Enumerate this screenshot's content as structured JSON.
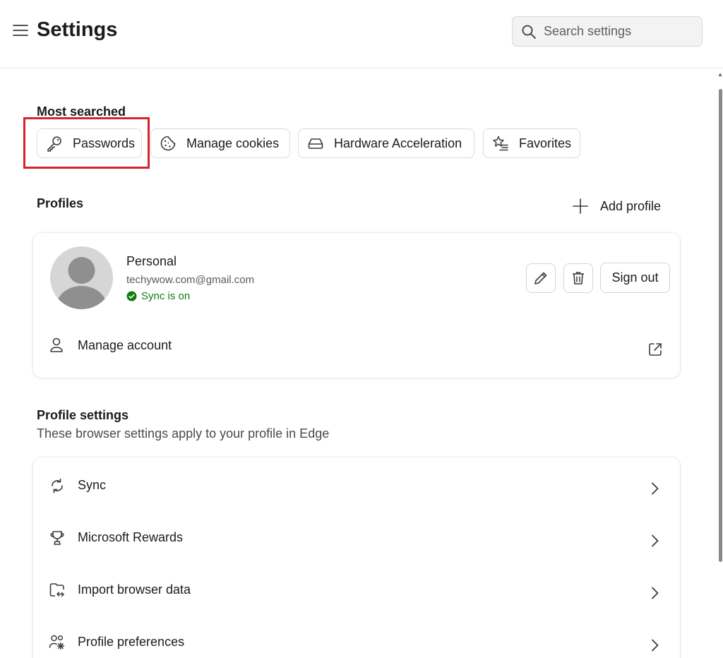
{
  "header": {
    "title": "Settings",
    "search_placeholder": "Search settings"
  },
  "most_searched": {
    "heading": "Most searched",
    "chips": [
      {
        "label": "Passwords",
        "icon": "key-icon"
      },
      {
        "label": "Manage cookies",
        "icon": "cookie-icon"
      },
      {
        "label": "Hardware Acceleration",
        "icon": "drive-icon"
      },
      {
        "label": "Favorites",
        "icon": "star-list-icon"
      }
    ],
    "highlight_color": "#d3242f"
  },
  "profiles": {
    "heading": "Profiles",
    "add_profile_label": "Add profile",
    "profile": {
      "name": "Personal",
      "email": "techywow.com@gmail.com",
      "sync_status": "Sync is on",
      "sync_color": "#107c10"
    },
    "sign_out_label": "Sign out",
    "manage_account_label": "Manage account"
  },
  "profile_settings": {
    "heading": "Profile settings",
    "subtext": "These browser settings apply to your profile in Edge",
    "items": [
      {
        "label": "Sync",
        "icon": "sync-icon"
      },
      {
        "label": "Microsoft Rewards",
        "icon": "trophy-icon"
      },
      {
        "label": "Import browser data",
        "icon": "import-icon"
      },
      {
        "label": "Profile preferences",
        "icon": "people-settings-icon"
      }
    ]
  }
}
